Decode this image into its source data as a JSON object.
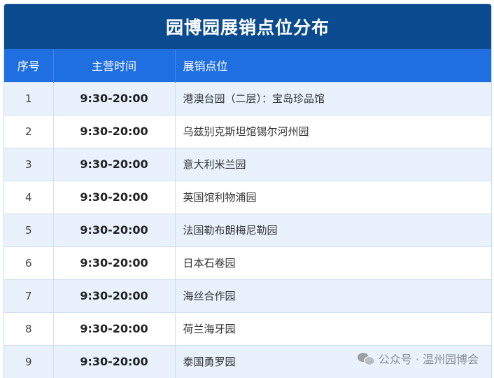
{
  "title": "园博园展销点位分布",
  "headers": {
    "index": "序号",
    "hours": "主营时间",
    "location": "展销点位"
  },
  "rows": [
    {
      "index": "1",
      "hours": "9:30-20:00",
      "location": "港澳台园（二层）：宝岛珍品馆"
    },
    {
      "index": "2",
      "hours": "9:30-20:00",
      "location": "乌兹别克斯坦馆锡尔河州园"
    },
    {
      "index": "3",
      "hours": "9:30-20:00",
      "location": "意大利米兰园"
    },
    {
      "index": "4",
      "hours": "9:30-20:00",
      "location": "英国馆利物浦园"
    },
    {
      "index": "5",
      "hours": "9:30-20:00",
      "location": "法国勒布朗梅尼勒园"
    },
    {
      "index": "6",
      "hours": "9:30-20:00",
      "location": "日本石卷园"
    },
    {
      "index": "7",
      "hours": "9:30-20:00",
      "location": "海丝合作园"
    },
    {
      "index": "8",
      "hours": "9:30-20:00",
      "location": "荷兰海牙园"
    },
    {
      "index": "9",
      "hours": "9:30-20:00",
      "location": "泰国勇罗园"
    }
  ],
  "watermark": {
    "icon": "wechat-icon",
    "text": "公众号 · 温州园博会"
  },
  "colors": {
    "title_bg": "#0a4a8f",
    "header_bg": "#1f6fe0",
    "row_alt_bg": "#e8f1fc"
  }
}
